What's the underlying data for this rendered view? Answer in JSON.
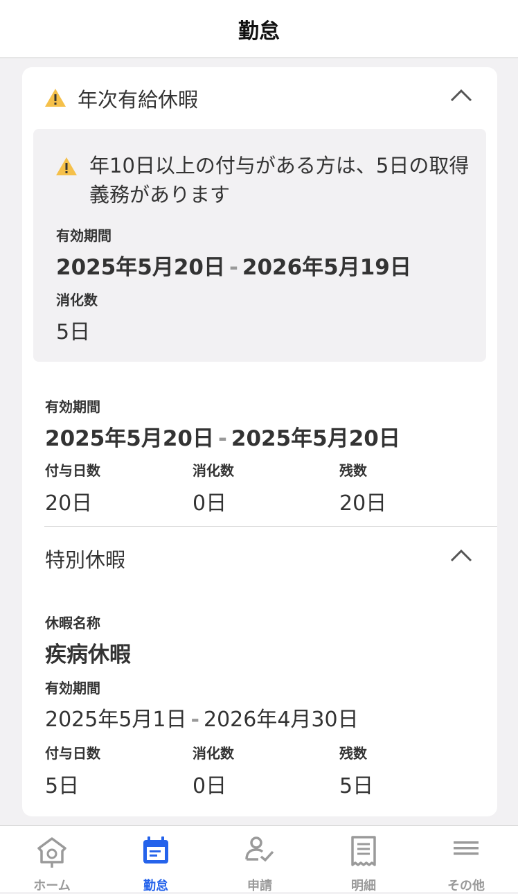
{
  "header": {
    "title": "勤怠"
  },
  "annual_leave": {
    "title": "年次有給休暇",
    "notice": "年10日以上の付与がある方は、5日の取得義務があります",
    "obligation": {
      "period_label": "有効期間",
      "period_start": "2025年5月20日",
      "period_end": "2026年5月19日",
      "consumed_label": "消化数",
      "consumed_value": "5日"
    },
    "grant": {
      "period_label": "有効期間",
      "period_start": "2025年5月20日",
      "period_end": "2025年5月20日",
      "granted_label": "付与日数",
      "granted_value": "20日",
      "consumed_label": "消化数",
      "consumed_value": "0日",
      "remaining_label": "残数",
      "remaining_value": "20日"
    }
  },
  "special_leave": {
    "title": "特別休暇",
    "name_label": "休暇名称",
    "name_value": "疾病休暇",
    "period_label": "有効期間",
    "period_start": "2025年5月1日",
    "period_end": "2026年4月30日",
    "granted_label": "付与日数",
    "granted_value": "5日",
    "consumed_label": "消化数",
    "consumed_value": "0日",
    "remaining_label": "残数",
    "remaining_value": "5日"
  },
  "period_separator": "-",
  "tabs": [
    {
      "label": "ホーム",
      "icon": "home-icon",
      "active": false
    },
    {
      "label": "勤怠",
      "icon": "calendar-icon",
      "active": true
    },
    {
      "label": "申請",
      "icon": "person-check-icon",
      "active": false
    },
    {
      "label": "明細",
      "icon": "receipt-icon",
      "active": false
    },
    {
      "label": "その他",
      "icon": "menu-icon",
      "active": false
    }
  ],
  "colors": {
    "accent": "#2563eb",
    "warning": "#f5c04a",
    "inactive": "#9a9a9a"
  }
}
